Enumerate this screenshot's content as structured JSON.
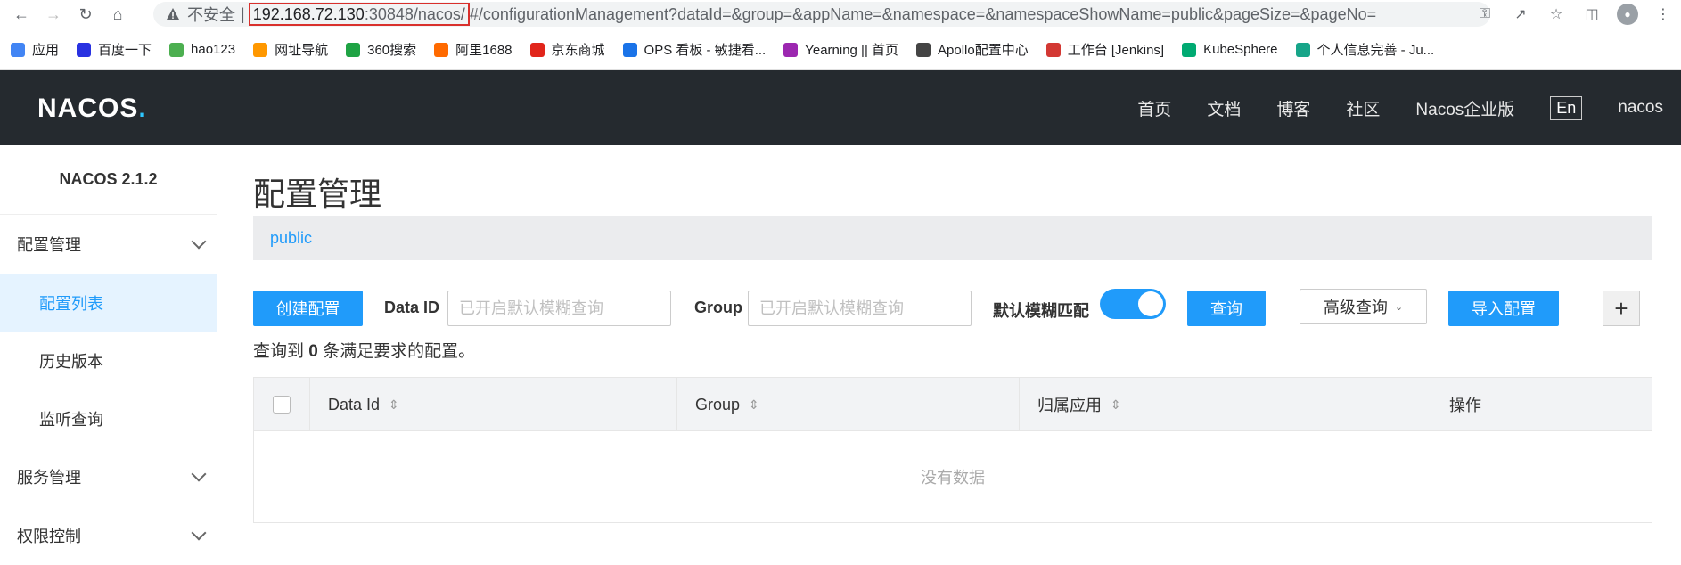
{
  "browser": {
    "insecure_label": "不安全",
    "separator": "|",
    "url_host": "192.168.72.130",
    "url_port_path": ":30848/nacos/",
    "url_rest": "#/configurationManagement?dataId=&group=&appName=&namespace=&namespaceShowName=public&pageSize=&pageNo="
  },
  "bookmarks": [
    {
      "label": "应用",
      "icon": "apps-grid-icon",
      "color": "#4285f4"
    },
    {
      "label": "百度一下",
      "icon": "baidu-icon",
      "color": "#2932e1"
    },
    {
      "label": "hao123",
      "icon": "hao123-icon",
      "color": "#4caf50"
    },
    {
      "label": "网址导航",
      "icon": "nav-icon",
      "color": "#ff9800"
    },
    {
      "label": "360搜索",
      "icon": "360-search-icon",
      "color": "#1fa344"
    },
    {
      "label": "阿里1688",
      "icon": "alibaba-icon",
      "color": "#ff6a00"
    },
    {
      "label": "京东商城",
      "icon": "jd-icon",
      "color": "#e1251b"
    },
    {
      "label": "OPS 看板 - 敏捷看...",
      "icon": "ops-diamond-icon",
      "color": "#1a73e8"
    },
    {
      "label": "Yearning || 首页",
      "icon": "yearning-icon",
      "color": "#9c27b0"
    },
    {
      "label": "Apollo配置中心",
      "icon": "apollo-icon",
      "color": "#444444"
    },
    {
      "label": "工作台 [Jenkins]",
      "icon": "jenkins-icon",
      "color": "#d33833"
    },
    {
      "label": "KubeSphere",
      "icon": "kubesphere-icon",
      "color": "#00aa72"
    },
    {
      "label": "个人信息完善 - Ju...",
      "icon": "layers-icon",
      "color": "#17a589"
    }
  ],
  "header": {
    "logo": "NACOS",
    "logo_dot": ".",
    "menu": [
      "首页",
      "文档",
      "博客",
      "社区",
      "Nacos企业版"
    ],
    "lang": "En",
    "user": "nacos"
  },
  "sidebar": {
    "version": "NACOS 2.1.2",
    "groups": [
      {
        "label": "配置管理",
        "items": [
          "配置列表",
          "历史版本",
          "监听查询"
        ],
        "active": "配置列表"
      },
      {
        "label": "服务管理"
      },
      {
        "label": "权限控制"
      }
    ]
  },
  "main": {
    "title": "配置管理",
    "namespace": "public",
    "create_button": "创建配置",
    "dataid_label": "Data ID",
    "dataid_placeholder": "已开启默认模糊查询",
    "group_label": "Group",
    "group_placeholder": "已开启默认模糊查询",
    "fuzzy_label": "默认模糊匹配",
    "fuzzy_on": true,
    "query_button": "查询",
    "advanced_button": "高级查询",
    "import_button": "导入配置",
    "plus": "+",
    "result_prefix": "查询到",
    "result_count": "0",
    "result_suffix": "条满足要求的配置。",
    "columns": [
      "Data Id",
      "Group",
      "归属应用",
      "操作"
    ],
    "empty_text": "没有数据"
  }
}
